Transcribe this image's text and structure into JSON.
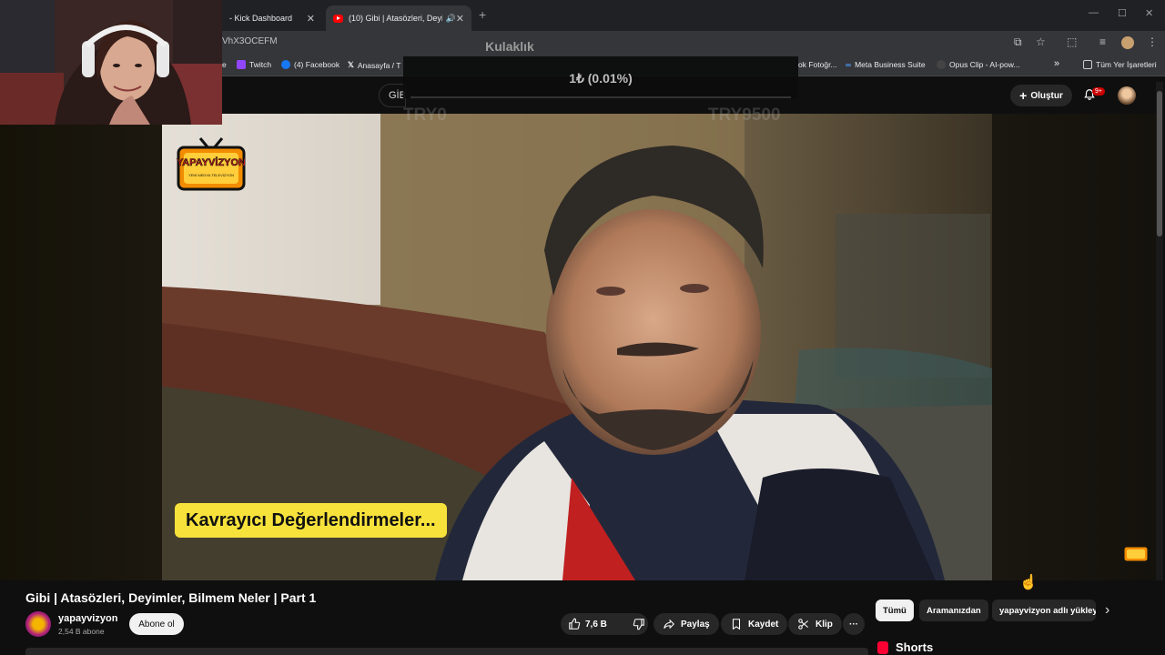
{
  "browser": {
    "tabs": [
      {
        "title": "- Kick Dashboard"
      },
      {
        "title": "(10) Gibi | Atasözleri, Deyim"
      }
    ],
    "url": "VhX3OCEFM",
    "bookmarks": [
      {
        "label": "e"
      },
      {
        "label": "Twitch"
      },
      {
        "label": "(4) Facebook"
      },
      {
        "label": "Anasayfa / T"
      },
      {
        "label": "ok Fotoğr..."
      },
      {
        "label": "Meta Business Suite"
      },
      {
        "label": "Opus Clip - AI-pow..."
      },
      {
        "label": "»"
      },
      {
        "label": "Tüm Yer İşaretleri"
      }
    ]
  },
  "overlay": {
    "title": "Kulaklık",
    "amount_text": "1₺ (0.01%)",
    "progress": 0.0001,
    "low_label": "TRY0",
    "high_label": "TRY9500"
  },
  "youtube_header": {
    "search_text": "GİB",
    "create_label": "Oluştur",
    "notif_badge": "9+"
  },
  "video": {
    "subtitle": "Kavrayıcı Değerlendirmeler...",
    "logo_text": "YAPAYVİZYON",
    "logo_subtext": "YENİ MEDYA TELEVİZYON",
    "title": "Gibi | Atasözleri, Deyimler, Bilmem Neler | Part 1"
  },
  "channel": {
    "name": "yapayvizyon",
    "subscribers": "2,54 B abone",
    "subscribe_label": "Abone ol"
  },
  "actions": {
    "likes": "7,6 B",
    "share_label": "Paylaş",
    "save_label": "Kaydet",
    "clip_label": "Klip",
    "more_label": "···"
  },
  "chips": [
    {
      "label": "Tümü"
    },
    {
      "label": "Aramanızdan"
    },
    {
      "label": "yapayvizyon adlı yükleyi"
    }
  ],
  "sidebar": {
    "shorts_label": "Shorts"
  },
  "colors": {
    "subtitle_bg": "#f7e23b",
    "yt_red": "#ff0000",
    "page_bg": "#0f0f0f"
  }
}
